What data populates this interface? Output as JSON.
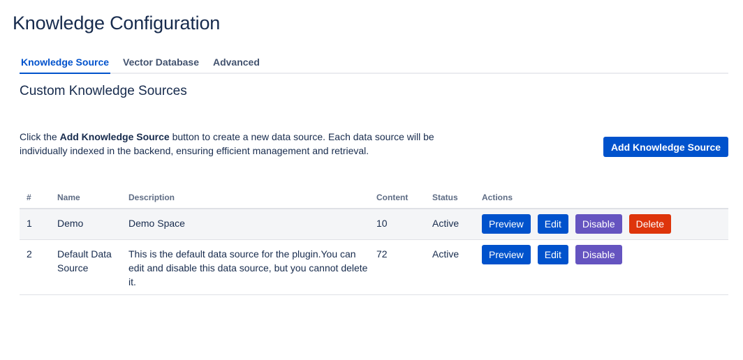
{
  "page": {
    "title": "Knowledge Configuration"
  },
  "tabs": [
    {
      "label": "Knowledge Source",
      "active": true
    },
    {
      "label": "Vector Database",
      "active": false
    },
    {
      "label": "Advanced",
      "active": false
    }
  ],
  "section": {
    "title": "Custom Knowledge Sources",
    "intro_prefix": "Click the ",
    "intro_bold": "Add Knowledge Source",
    "intro_suffix": " button to create a new data source. Each data source will be individually indexed in the backend, ensuring efficient management and retrieval."
  },
  "add_button": {
    "label": "Add Knowledge Source"
  },
  "table": {
    "headers": [
      "#",
      "Name",
      "Description",
      "Content",
      "Status",
      "Actions"
    ],
    "rows": [
      {
        "num": "1",
        "name": "Demo",
        "description": "Demo Space",
        "content": "10",
        "status": "Active",
        "actions": {
          "preview": "Preview",
          "edit": "Edit",
          "disable": "Disable",
          "delete": "Delete"
        }
      },
      {
        "num": "2",
        "name": "Default Data Source",
        "description": "This is the default data source for the plugin.You can edit and disable this data source, but you cannot delete it.",
        "content": "72",
        "status": "Active",
        "actions": {
          "preview": "Preview",
          "edit": "Edit",
          "disable": "Disable"
        }
      }
    ]
  },
  "colors": {
    "primary": "#0052cc",
    "purple": "#6554c0",
    "danger": "#de350b",
    "text": "#172b4d"
  }
}
